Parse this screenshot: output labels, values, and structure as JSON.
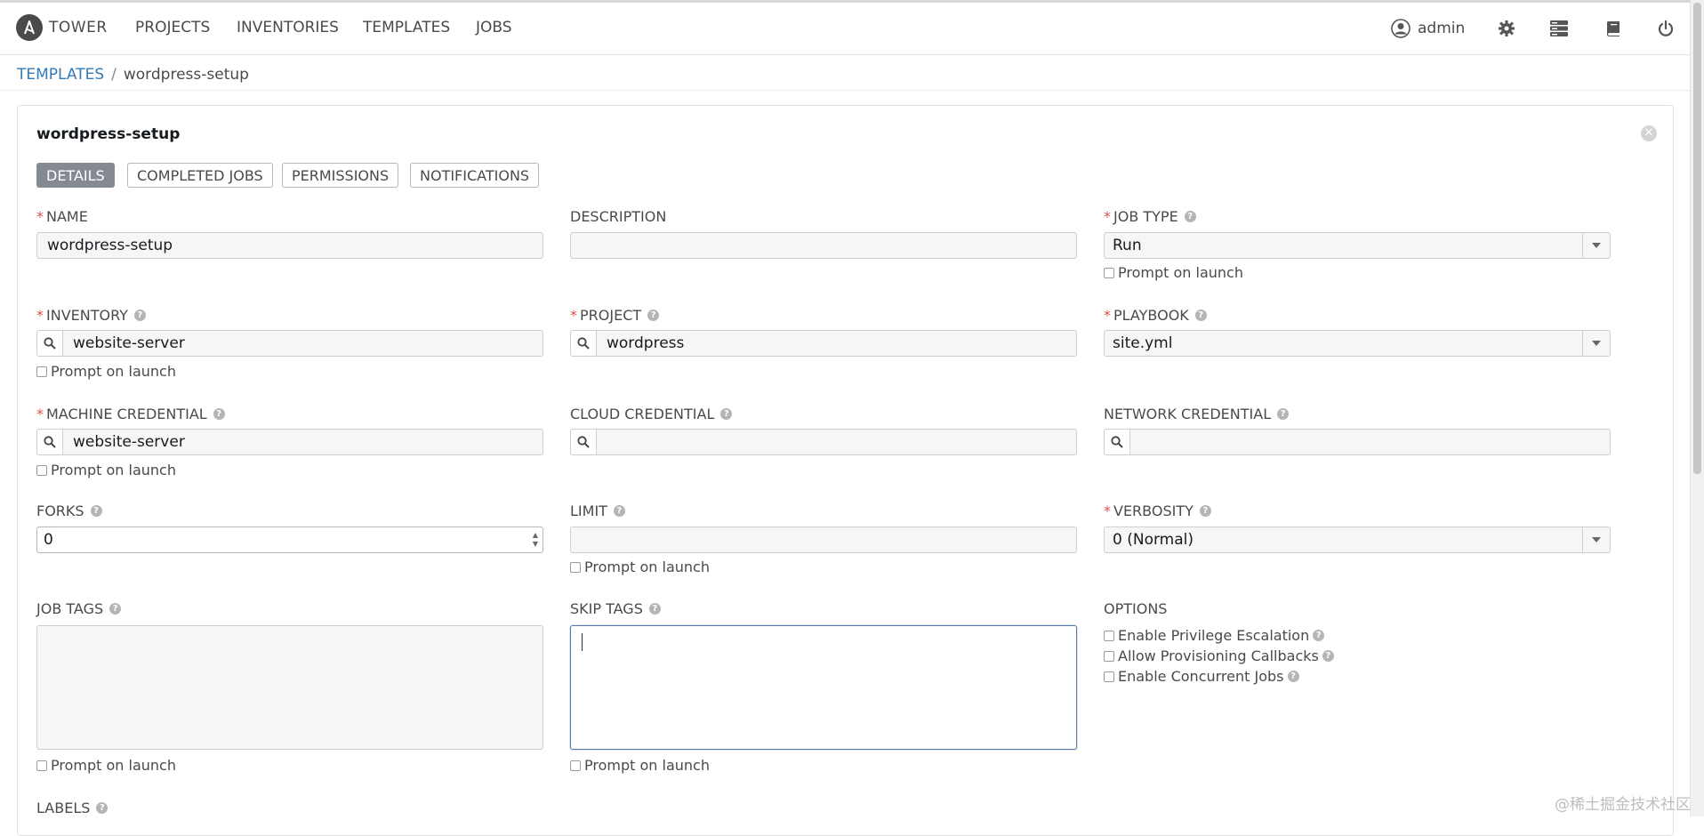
{
  "nav": {
    "brand": "TOWER",
    "links": [
      "PROJECTS",
      "INVENTORIES",
      "TEMPLATES",
      "JOBS"
    ],
    "user": "admin",
    "icons": [
      "user-icon",
      "gear-icon",
      "server-icon",
      "book-icon",
      "power-icon"
    ]
  },
  "breadcrumb": {
    "parent": "TEMPLATES",
    "separator": "/",
    "current": "wordpress-setup"
  },
  "panel": {
    "title": "wordpress-setup",
    "tabs": [
      "DETAILS",
      "COMPLETED JOBS",
      "PERMISSIONS",
      "NOTIFICATIONS"
    ],
    "active_tab": "DETAILS"
  },
  "form": {
    "required_mark": "*",
    "help_glyph": "?",
    "prompt_label": "Prompt on launch",
    "name": {
      "label": "NAME",
      "value": "wordpress-setup"
    },
    "description": {
      "label": "DESCRIPTION",
      "value": ""
    },
    "job_type": {
      "label": "JOB TYPE",
      "value": "Run"
    },
    "inventory": {
      "label": "INVENTORY",
      "value": "website-server"
    },
    "project": {
      "label": "PROJECT",
      "value": "wordpress"
    },
    "playbook": {
      "label": "PLAYBOOK",
      "value": "site.yml"
    },
    "machine_credential": {
      "label": "MACHINE CREDENTIAL",
      "value": "website-server"
    },
    "cloud_credential": {
      "label": "CLOUD CREDENTIAL",
      "value": ""
    },
    "network_credential": {
      "label": "NETWORK CREDENTIAL",
      "value": ""
    },
    "forks": {
      "label": "FORKS",
      "value": "0"
    },
    "limit": {
      "label": "LIMIT",
      "value": ""
    },
    "verbosity": {
      "label": "VERBOSITY",
      "value": "0 (Normal)"
    },
    "job_tags": {
      "label": "JOB TAGS",
      "value": ""
    },
    "skip_tags": {
      "label": "SKIP TAGS",
      "value": ""
    },
    "options": {
      "label": "OPTIONS",
      "items": [
        "Enable Privilege Escalation",
        "Allow Provisioning Callbacks",
        "Enable Concurrent Jobs"
      ]
    },
    "labels": {
      "label": "LABELS"
    }
  },
  "watermark": "@稀土掘金技术社区"
}
